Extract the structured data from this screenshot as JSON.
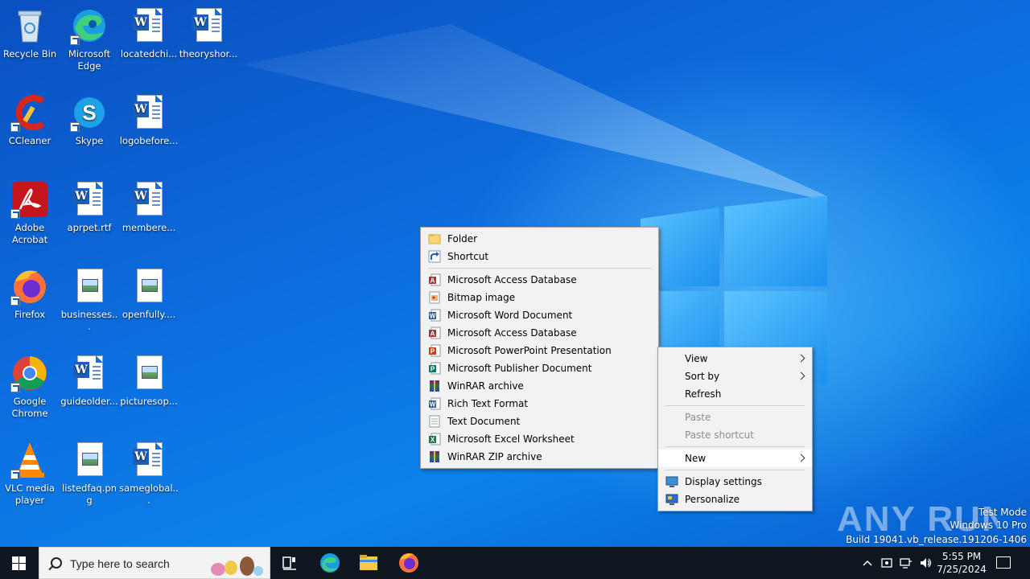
{
  "desktop": {
    "icons": [
      {
        "label": "Recycle Bin",
        "icon": "recycle-bin-icon"
      },
      {
        "label": "Microsoft Edge",
        "icon": "edge-icon"
      },
      {
        "label": "locatedchi...",
        "icon": "word-doc-icon"
      },
      {
        "label": "theoryshor...",
        "icon": "word-doc-icon"
      },
      {
        "label": "CCleaner",
        "icon": "ccleaner-icon"
      },
      {
        "label": "Skype",
        "icon": "skype-icon"
      },
      {
        "label": "logobefore...",
        "icon": "word-doc-icon"
      },
      {
        "label": "Adobe Acrobat",
        "icon": "acrobat-icon"
      },
      {
        "label": "aprpet.rtf",
        "icon": "word-doc-icon"
      },
      {
        "label": "membere...",
        "icon": "word-doc-icon"
      },
      {
        "label": "Firefox",
        "icon": "firefox-icon"
      },
      {
        "label": "businesses...",
        "icon": "image-file-icon"
      },
      {
        "label": "openfully....",
        "icon": "image-file-icon"
      },
      {
        "label": "Google Chrome",
        "icon": "chrome-icon"
      },
      {
        "label": "guideolder...",
        "icon": "word-doc-icon"
      },
      {
        "label": "picturesop...",
        "icon": "image-file-icon"
      },
      {
        "label": "VLC media player",
        "icon": "vlc-icon"
      },
      {
        "label": "listedfaq.png",
        "icon": "image-file-icon"
      },
      {
        "label": "sameglobal...",
        "icon": "word-doc-icon"
      }
    ]
  },
  "context_menu": {
    "items": [
      {
        "label": "View",
        "submenu": true,
        "disabled": false
      },
      {
        "label": "Sort by",
        "submenu": true,
        "disabled": false
      },
      {
        "label": "Refresh",
        "submenu": false,
        "disabled": false
      },
      {
        "label": "Paste",
        "submenu": false,
        "disabled": true
      },
      {
        "label": "Paste shortcut",
        "submenu": false,
        "disabled": true
      },
      {
        "label": "New",
        "submenu": true,
        "disabled": false,
        "highlighted": true
      },
      {
        "label": "Display settings",
        "icon": "display-settings-icon",
        "disabled": false
      },
      {
        "label": "Personalize",
        "icon": "personalize-icon",
        "disabled": false
      }
    ]
  },
  "new_submenu": {
    "items": [
      {
        "label": "Folder",
        "icon": "folder-icon"
      },
      {
        "label": "Shortcut",
        "icon": "shortcut-icon"
      },
      {
        "label": "Microsoft Access Database",
        "icon": "access-icon",
        "color": "#a4373a",
        "letter": "A"
      },
      {
        "label": "Bitmap image",
        "icon": "bitmap-icon",
        "color": "#c87a3a",
        "letter": ""
      },
      {
        "label": "Microsoft Word Document",
        "icon": "word-icon",
        "color": "#2b5797",
        "letter": "W"
      },
      {
        "label": "Microsoft Access Database",
        "icon": "access-icon",
        "color": "#a4373a",
        "letter": "A"
      },
      {
        "label": "Microsoft PowerPoint Presentation",
        "icon": "powerpoint-icon",
        "color": "#c43e1c",
        "letter": "P"
      },
      {
        "label": "Microsoft Publisher Document",
        "icon": "publisher-icon",
        "color": "#077568",
        "letter": "P"
      },
      {
        "label": "WinRAR archive",
        "icon": "winrar-icon",
        "color": "#7a2a6e",
        "letter": ""
      },
      {
        "label": "Rich Text Format",
        "icon": "rtf-icon",
        "color": "#2b5797",
        "letter": "W"
      },
      {
        "label": "Text Document",
        "icon": "text-doc-icon",
        "color": "#ffffff",
        "letter": ""
      },
      {
        "label": "Microsoft Excel Worksheet",
        "icon": "excel-icon",
        "color": "#217346",
        "letter": "X"
      },
      {
        "label": "WinRAR ZIP archive",
        "icon": "winrar-zip-icon",
        "color": "#7a2a6e",
        "letter": ""
      }
    ]
  },
  "taskbar": {
    "search_placeholder": "Type here to search",
    "apps": [
      "task-view-icon",
      "edge-icon",
      "file-explorer-icon",
      "firefox-icon"
    ],
    "time": "5:55 PM",
    "date": "7/25/2024"
  },
  "watermark": {
    "logo": "ANY RUN",
    "mode": "Test Mode",
    "edition": "Windows 10 Pro",
    "build": "Build 19041.vb_release.191206-1406"
  },
  "colors": {
    "taskbar": "#0e1620",
    "menu_bg": "#f2f2f2",
    "wallpaper": "#0a6fd8"
  }
}
